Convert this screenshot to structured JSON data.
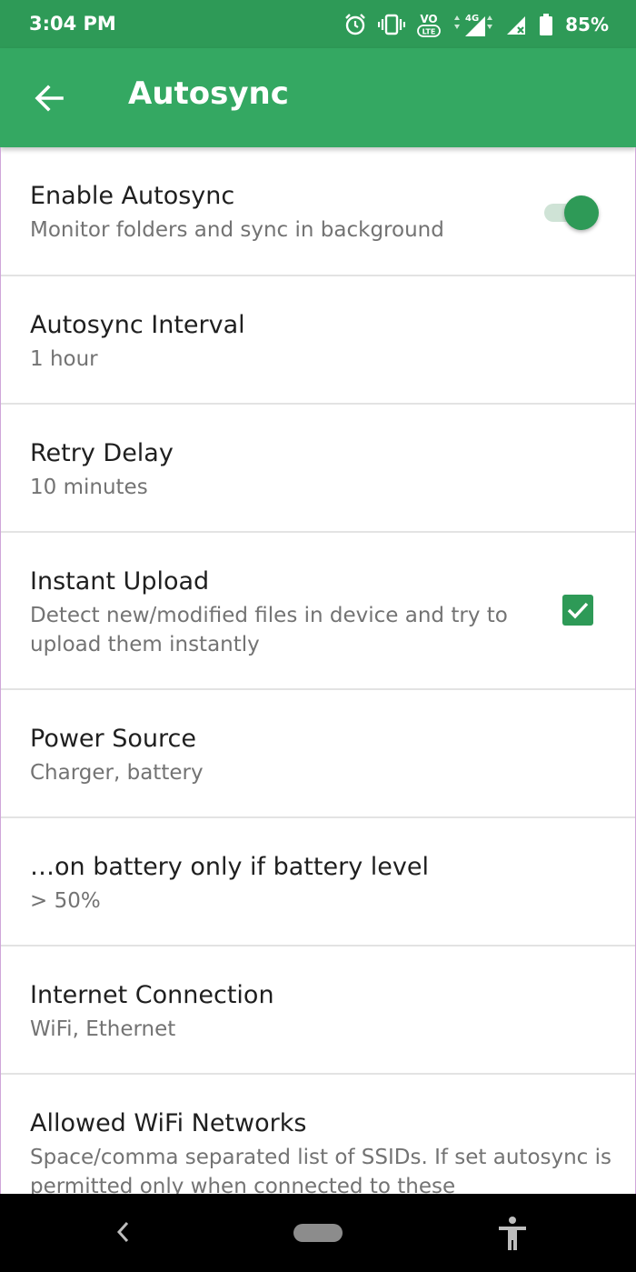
{
  "status_bar": {
    "time": "3:04 PM",
    "battery_percent": "85%",
    "icons": [
      "alarm-icon",
      "vibrate-icon",
      "volte-icon",
      "signal-4g-icon",
      "signal-no-sim-icon",
      "battery-icon"
    ],
    "volte_text": "VO",
    "lte_text": "LTE",
    "network_type": "4G"
  },
  "app_bar": {
    "title": "Autosync",
    "back_icon": "arrow-left-icon"
  },
  "settings": [
    {
      "title": "Enable Autosync",
      "summary": "Monitor folders and sync in background",
      "control": "toggle",
      "checked": true
    },
    {
      "title": "Autosync Interval",
      "summary": "1 hour"
    },
    {
      "title": "Retry Delay",
      "summary": "10 minutes"
    },
    {
      "title": "Instant Upload",
      "summary": "Detect new/modified files in device and try to upload them instantly",
      "control": "checkbox",
      "checked": true
    },
    {
      "title": "Power Source",
      "summary": "Charger, battery"
    },
    {
      "title": "…on battery only if battery level",
      "summary": "> 50%"
    },
    {
      "title": "Internet Connection",
      "summary": "WiFi, Ethernet"
    },
    {
      "title": "Allowed WiFi Networks",
      "summary": "Space/comma separated list of SSIDs. If set autosync is permitted only when connected to these"
    }
  ],
  "nav_bar": {
    "icons": [
      "nav-back-icon",
      "nav-home-pill",
      "accessibility-icon"
    ]
  },
  "colors": {
    "status_bar": "#2e9a57",
    "app_bar": "#34a862",
    "accent": "#2e9a57"
  }
}
